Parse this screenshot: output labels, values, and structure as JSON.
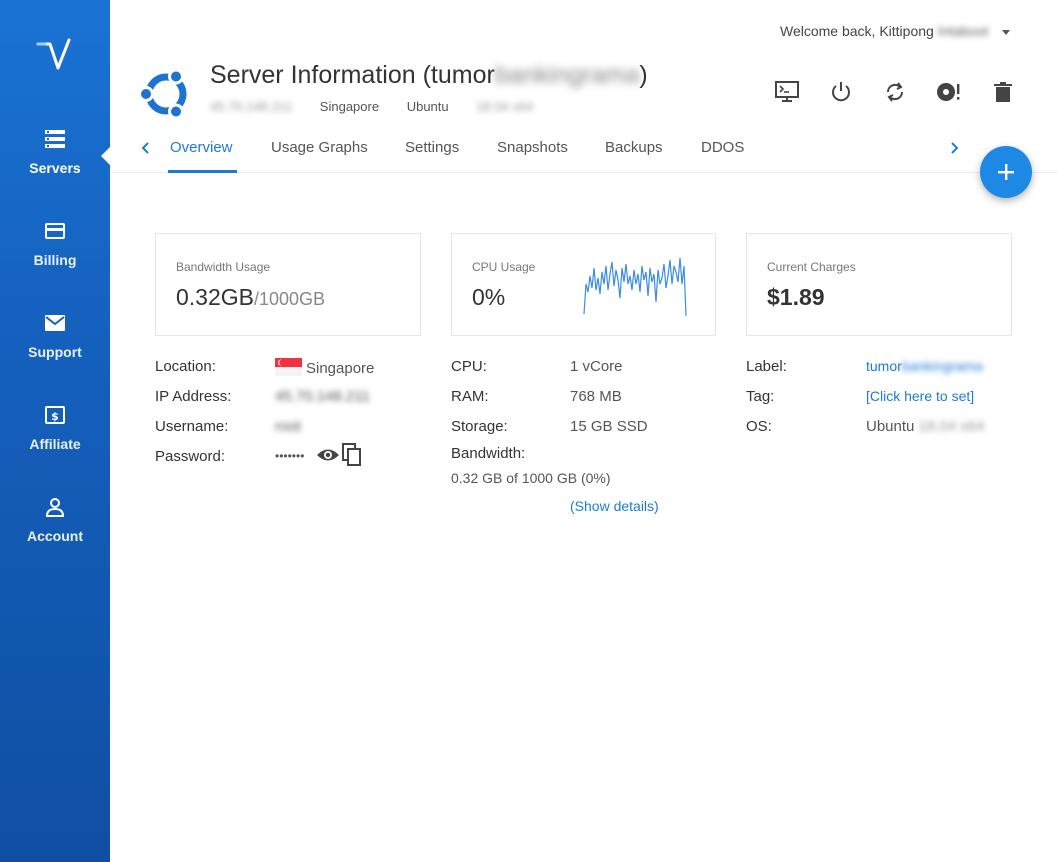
{
  "sidebar": {
    "logo": "vultr-v-logo",
    "items": [
      {
        "label": "Servers",
        "icon": "server-stack-icon",
        "active": true
      },
      {
        "label": "Billing",
        "icon": "credit-card-icon"
      },
      {
        "label": "Support",
        "icon": "envelope-icon"
      },
      {
        "label": "Affiliate",
        "icon": "dollar-bill-icon"
      },
      {
        "label": "Account",
        "icon": "user-icon"
      }
    ]
  },
  "header": {
    "welcome_prefix": "Welcome back, Kittipong",
    "welcome_blurred": "Intaboot",
    "title_prefix": "Server Information (tumor",
    "title_blurred": "bankingrama",
    "title_suffix": ")",
    "ip_blurred": "45.70.148.211",
    "location": "Singapore",
    "os_prefix": "Ubuntu",
    "os_blurred": "18.04 x64",
    "actions": [
      "console-icon",
      "power-icon",
      "restart-icon",
      "reinstall-icon",
      "trash-icon"
    ]
  },
  "tabs": {
    "items": [
      "Overview",
      "Usage Graphs",
      "Settings",
      "Snapshots",
      "Backups",
      "DDOS"
    ],
    "active": "Overview"
  },
  "cards": {
    "bandwidth": {
      "title": "Bandwidth Usage",
      "value": "0.32GB",
      "sub": "/1000GB"
    },
    "cpu": {
      "title": "CPU Usage",
      "value": "0%"
    },
    "charges": {
      "title": "Current Charges",
      "value": "$1.89"
    }
  },
  "server_details": {
    "location_label": "Location:",
    "location_value": "Singapore",
    "ip_label": "IP Address:",
    "ip_value_blurred": "45.70.148.211",
    "username_label": "Username:",
    "username_value_blurred": "root",
    "password_label": "Password:",
    "password_value": "•••••••"
  },
  "specs": {
    "cpu_label": "CPU:",
    "cpu_value": "1 vCore",
    "ram_label": "RAM:",
    "ram_value": "768 MB",
    "storage_label": "Storage:",
    "storage_value": "15 GB SSD",
    "bandwidth_label": "Bandwidth:",
    "bandwidth_value": "0.32 GB of 1000 GB (0%)",
    "show_details": "(Show details)"
  },
  "meta": {
    "label_label": "Label:",
    "label_prefix": "tumor",
    "label_blurred": "bankingrama",
    "tag_label": "Tag:",
    "tag_value": "[Click here to set]",
    "os_label": "OS:",
    "os_prefix": "Ubuntu",
    "os_blurred": "18.04 x64"
  },
  "colors": {
    "accent": "#1f7ad6",
    "sidebar": "#1560bd",
    "fab": "#1e88e5"
  }
}
